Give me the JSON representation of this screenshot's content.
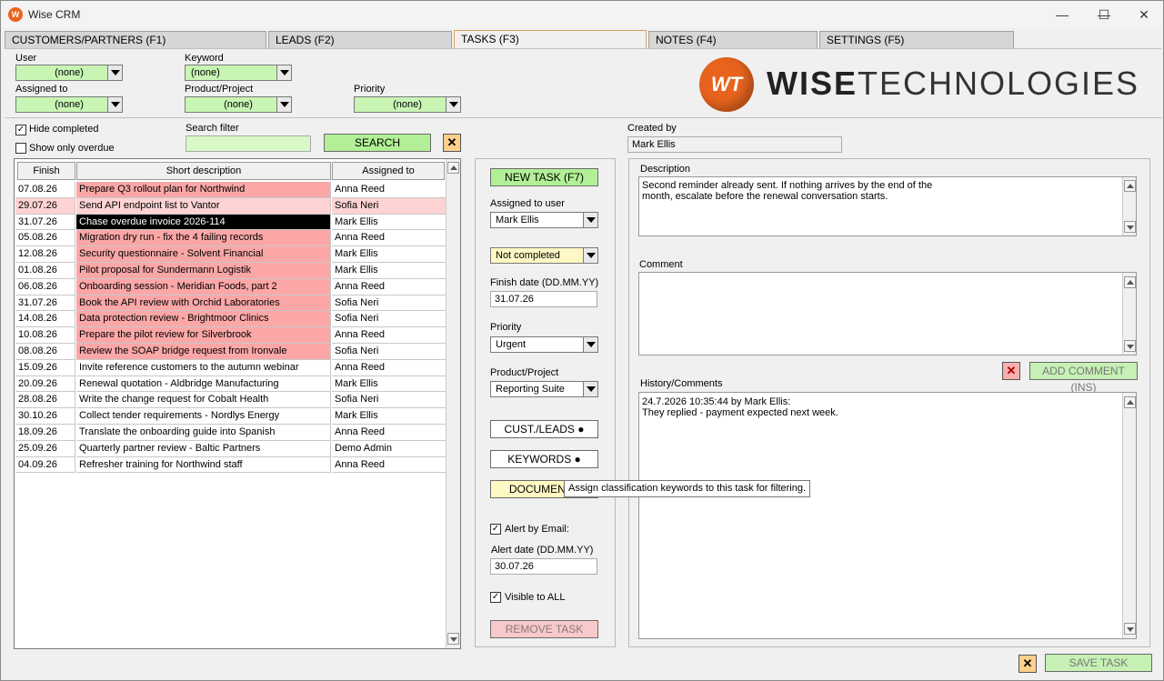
{
  "window": {
    "title": "Wise CRM",
    "minimize": "—",
    "maximize": "☐",
    "close": "✕"
  },
  "tabs": [
    "CUSTOMERS/PARTNERS (F1)",
    "LEADS (F2)",
    "TASKS (F3)",
    "NOTES (F4)",
    "SETTINGS (F5)"
  ],
  "filters": {
    "user_label": "User",
    "user_value": "(none)",
    "keyword_label": "Keyword",
    "keyword_value": "(none)",
    "assigned_label": "Assigned to",
    "assigned_value": "(none)",
    "product_label": "Product/Project",
    "product_value": "(none)",
    "priority_label": "Priority",
    "priority_value": "(none)"
  },
  "logo": {
    "bold": "WISE",
    "light": "TECHNOLOGIES",
    "mark": "WT"
  },
  "list_controls": {
    "hide_completed": "Hide completed",
    "show_overdue": "Show only overdue",
    "search_label": "Search filter",
    "search_value": "",
    "search_button": "SEARCH",
    "clear": "✕"
  },
  "grid": {
    "headers": [
      "Finish",
      "Short description",
      "Assigned to"
    ],
    "rows": [
      {
        "finish": "07.08.26",
        "desc": "Prepare Q3 rollout plan for Northwind",
        "assigned": "Anna Reed",
        "status": "overdue"
      },
      {
        "finish": "29.07.26",
        "desc": "Send API endpoint list to Vantor",
        "assigned": "Sofia Neri",
        "status": "light"
      },
      {
        "finish": "31.07.26",
        "desc": "Chase overdue invoice 2026-114",
        "assigned": "Mark Ellis",
        "status": "selected"
      },
      {
        "finish": "05.08.26",
        "desc": "Migration dry run - fix the 4 failing records",
        "assigned": "Anna Reed",
        "status": "overdue"
      },
      {
        "finish": "12.08.26",
        "desc": "Security questionnaire - Solvent Financial",
        "assigned": "Mark Ellis",
        "status": "overdue"
      },
      {
        "finish": "01.08.26",
        "desc": "Pilot proposal for Sundermann Logistik",
        "assigned": "Mark Ellis",
        "status": "overdue"
      },
      {
        "finish": "06.08.26",
        "desc": "Onboarding session - Meridian Foods, part 2",
        "assigned": "Anna Reed",
        "status": "overdue"
      },
      {
        "finish": "31.07.26",
        "desc": "Book the API review with Orchid Laboratories",
        "assigned": "Sofia Neri",
        "status": "overdue"
      },
      {
        "finish": "14.08.26",
        "desc": "Data protection review - Brightmoor Clinics",
        "assigned": "Sofia Neri",
        "status": "overdue"
      },
      {
        "finish": "10.08.26",
        "desc": "Prepare the pilot review for Silverbrook",
        "assigned": "Anna Reed",
        "status": "overdue"
      },
      {
        "finish": "08.08.26",
        "desc": "Review the SOAP bridge request from Ironvale",
        "assigned": "Sofia Neri",
        "status": "overdue"
      },
      {
        "finish": "15.09.26",
        "desc": "Invite reference customers to the autumn webinar",
        "assigned": "Anna Reed",
        "status": "normal"
      },
      {
        "finish": "20.09.26",
        "desc": "Renewal quotation - Aldbridge Manufacturing",
        "assigned": "Mark Ellis",
        "status": "normal"
      },
      {
        "finish": "28.08.26",
        "desc": "Write the change request for Cobalt Health",
        "assigned": "Sofia Neri",
        "status": "normal"
      },
      {
        "finish": "30.10.26",
        "desc": "Collect tender requirements - Nordlys Energy",
        "assigned": "Mark Ellis",
        "status": "normal"
      },
      {
        "finish": "18.09.26",
        "desc": "Translate the onboarding guide into Spanish",
        "assigned": "Anna Reed",
        "status": "normal"
      },
      {
        "finish": "25.09.26",
        "desc": "Quarterly partner review - Baltic Partners",
        "assigned": "Demo Admin",
        "status": "normal"
      },
      {
        "finish": "04.09.26",
        "desc": "Refresher training for Northwind staff",
        "assigned": "Anna Reed",
        "status": "normal"
      }
    ]
  },
  "task": {
    "new_task": "NEW TASK (F7)",
    "assigned_user_label": "Assigned to user",
    "assigned_user": "Mark Ellis",
    "status": "Not completed",
    "finish_label": "Finish date (DD.MM.YY)",
    "finish_date": "31.07.26",
    "priority_label": "Priority",
    "priority": "Urgent",
    "product_label": "Product/Project",
    "product": "Reporting Suite",
    "cust_leads": "CUST./LEADS  ●",
    "keywords": "KEYWORDS  ●",
    "documents": "DOCUMENTS",
    "alert_email": "Alert by Email:",
    "alert_label": "Alert date (DD.MM.YY)",
    "alert_date": "30.07.26",
    "visible_all": "Visible to ALL",
    "remove": "REMOVE TASK",
    "tooltip": "Assign classification keywords to this task for filtering."
  },
  "detail": {
    "created_label": "Created by",
    "created_by": "Mark Ellis",
    "description_label": "Description",
    "description_line1": "Second reminder already sent. If nothing arrives by the end of the",
    "description_line2": "month, escalate before the renewal conversation starts.",
    "comment_label": "Comment",
    "add_comment": "ADD COMMENT (INS)",
    "history_label": "History/Comments",
    "history_line1": "24.7.2026 10:35:44 by Mark Ellis:",
    "history_line2": "They replied - payment expected next week.",
    "save": "SAVE TASK"
  },
  "colors": {
    "overdue": "#fca7a7",
    "light": "#fdd3d3",
    "selected": "#000000",
    "accent": "#e8641e",
    "green": "#b2ef96"
  }
}
